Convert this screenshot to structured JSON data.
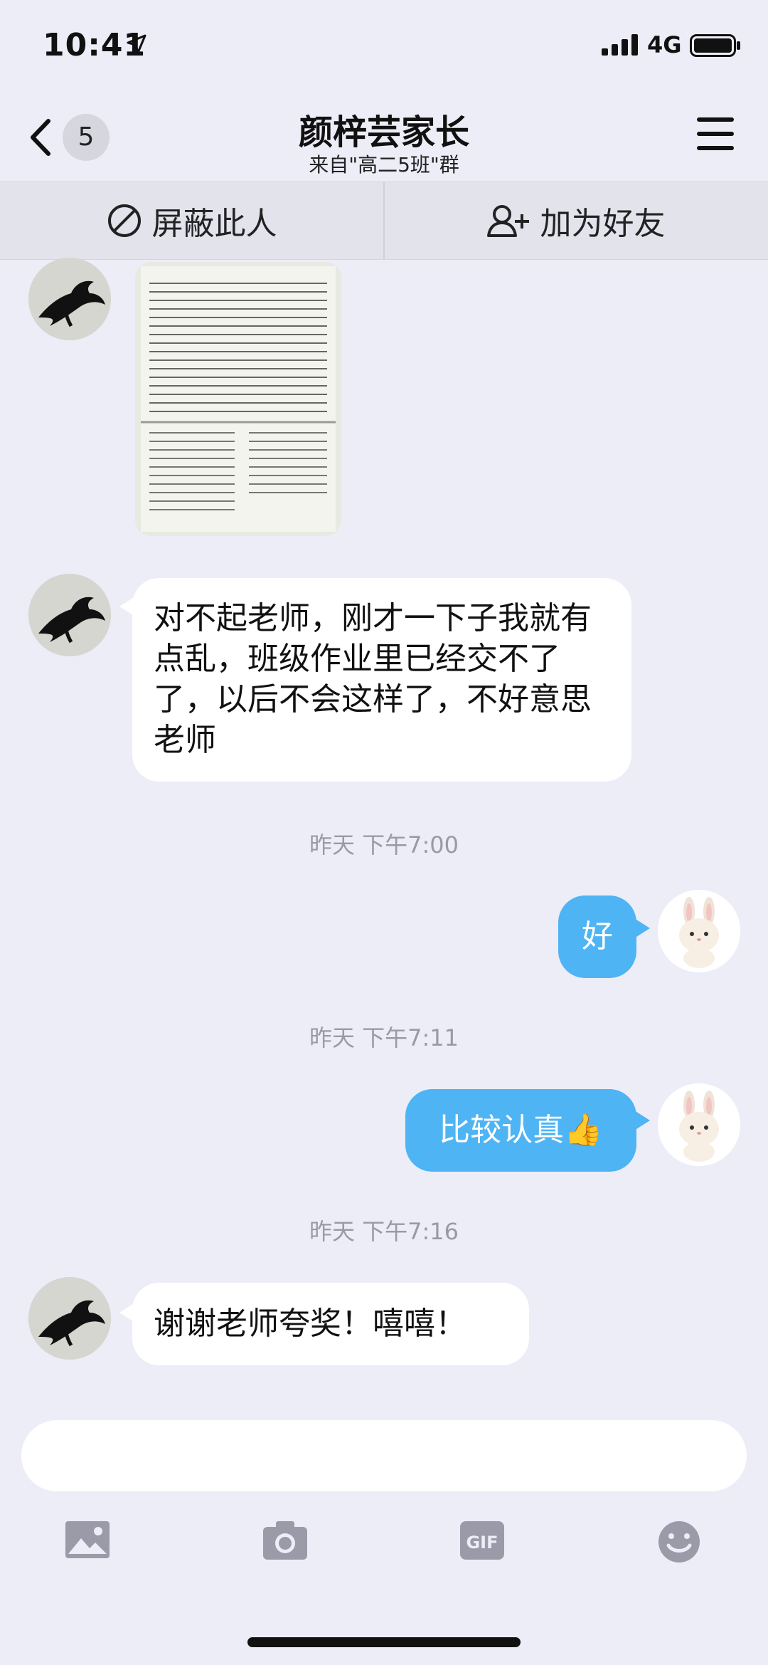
{
  "status_bar": {
    "time": "10:41",
    "network": "4G"
  },
  "header": {
    "back_count": "5",
    "title": "颜梓芸家长",
    "subtitle": "来自\"高二5班\"群"
  },
  "actions": {
    "block": "屏蔽此人",
    "add_friend": "加为好友"
  },
  "messages": [
    {
      "from": "other",
      "type": "image"
    },
    {
      "from": "other",
      "type": "text",
      "text": "对不起老师，刚才一下子我就有点乱，班级作业里已经交不了了，以后不会这样了，不好意思老师"
    },
    {
      "type": "timestamp",
      "text": "昨天 下午7:00"
    },
    {
      "from": "me",
      "type": "text",
      "text": "好"
    },
    {
      "type": "timestamp",
      "text": "昨天 下午7:11"
    },
    {
      "from": "me",
      "type": "text",
      "text": "比较认真👍"
    },
    {
      "type": "timestamp",
      "text": "昨天 下午7:16"
    },
    {
      "from": "other",
      "type": "text",
      "text": "谢谢老师夸奖！嘻嘻！"
    }
  ],
  "input": {
    "placeholder": ""
  },
  "toolbar": [
    "image-icon",
    "camera-icon",
    "gif-icon",
    "emoji-icon"
  ],
  "colors": {
    "background": "#EDEDF8",
    "outgoing_bubble": "#4EB4F4",
    "incoming_bubble": "#FFFFFF"
  }
}
